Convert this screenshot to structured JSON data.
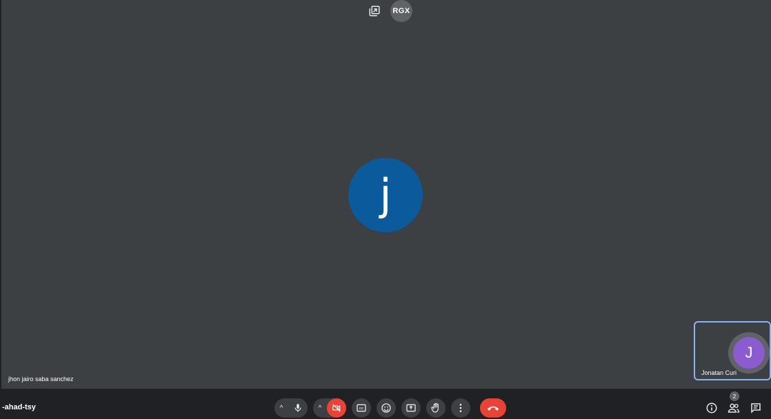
{
  "top": {
    "account_label": "RGX"
  },
  "main": {
    "avatar_initial": "j",
    "participant_name": "jhon jairo saba sanchez"
  },
  "self_view": {
    "avatar_initial": "J",
    "name": "Jonatan Curi"
  },
  "bottom": {
    "meeting_code": "-ahad-tsy",
    "participant_count": "2"
  },
  "colors": {
    "stage_bg": "#3c4043",
    "main_avatar": "#0b5a9c",
    "self_avatar": "#8a5ccf",
    "end_call": "#ea4335",
    "self_tile_border": "#8ab4f8"
  },
  "icons": [
    "picture-in-picture-icon",
    "microphone-icon",
    "camera-off-icon",
    "captions-icon",
    "emoji-icon",
    "present-screen-icon",
    "raise-hand-icon",
    "more-options-icon",
    "end-call-icon",
    "info-icon",
    "people-icon",
    "chat-icon"
  ]
}
